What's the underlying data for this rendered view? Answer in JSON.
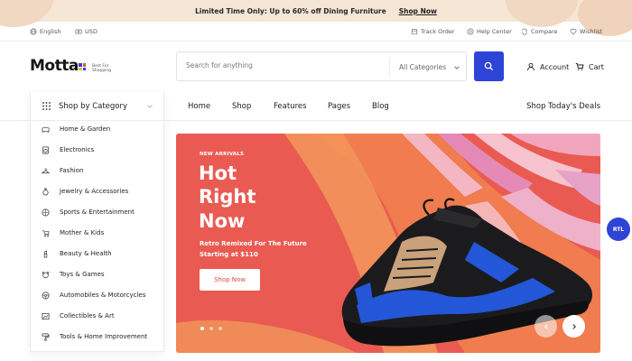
{
  "promo": {
    "text": "Limited Time Only: Up to 60% off Dining Furniture",
    "link": "Shop Now"
  },
  "topbar": {
    "language": "English",
    "currency": "USD",
    "track_order": "Track Order",
    "help_center": "Help Center",
    "compare": "Compare",
    "wishlist": "Wishlist"
  },
  "brand": {
    "name": "Motta",
    "tagline_1": "Best For",
    "tagline_2": "Shopping"
  },
  "search": {
    "placeholder": "Search for anything",
    "category": "All Categories"
  },
  "account": {
    "account_label": "Account",
    "cart_label": "Cart"
  },
  "nav": {
    "items": [
      "Home",
      "Shop",
      "Features",
      "Pages",
      "Blog"
    ],
    "deals": "Shop Today's Deals"
  },
  "categories": {
    "title": "Shop by Category",
    "items": [
      "Home & Garden",
      "Electronics",
      "Fashion",
      "Jewelry & Accessories",
      "Sports & Entertainment",
      "Mother & Kids",
      "Beauty & Health",
      "Toys & Games",
      "Automobiles & Motorcycles",
      "Collectibles & Art",
      "Tools & Home Improvement"
    ]
  },
  "hero": {
    "eyebrow": "NEW ARRIVALS",
    "title_1": "Hot",
    "title_2": "Right",
    "title_3": "Now",
    "sub_1": "Retro Remixed For The Future",
    "sub_2": "Starting at $110",
    "cta": "Shop Now"
  },
  "rtl": "RTL",
  "colors": {
    "accent": "#2d44d7",
    "hero_red": "#e85a52",
    "promo_bg": "#f6e6d6"
  }
}
